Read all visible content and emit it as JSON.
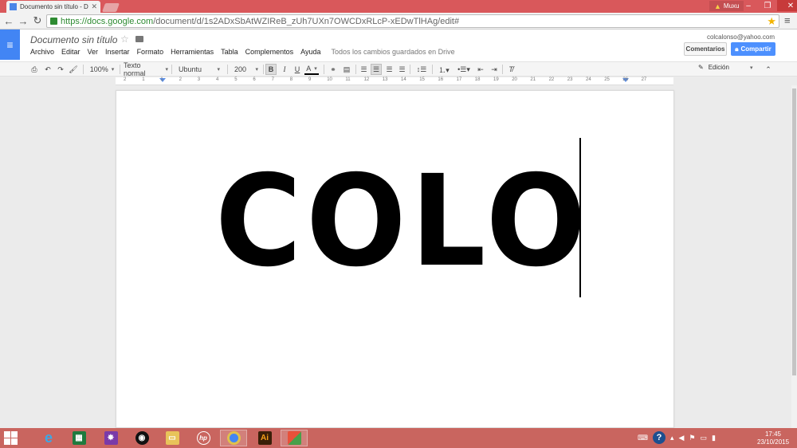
{
  "browser": {
    "tab_title": "Documento sin título - Docs",
    "url_main": "https://docs.google.com",
    "url_rest": "/document/d/1s2ADxSbAtWZIReB_zUh7UXn7OWCDxRLcP-xEDwTlHAg/edit#",
    "user_badge": "Muxu"
  },
  "docs": {
    "title": "Documento sin título",
    "menus": [
      "Archivo",
      "Editar",
      "Ver",
      "Insertar",
      "Formato",
      "Herramientas",
      "Tabla",
      "Complementos",
      "Ayuda"
    ],
    "saved_status": "Todos los cambios guardados en Drive",
    "email": "colcalonso@yahoo.com",
    "comments_label": "Comentarios",
    "share_label": "Compartir"
  },
  "toolbar": {
    "zoom": "100%",
    "style": "Texto normal",
    "font": "Ubuntu",
    "size": "200",
    "bold": "B",
    "italic": "I",
    "underline": "U",
    "text_color": "A",
    "mode": "Edición"
  },
  "ruler": [
    "2",
    "1",
    "1",
    "2",
    "3",
    "4",
    "5",
    "6",
    "7",
    "8",
    "9",
    "10",
    "11",
    "12",
    "13",
    "14",
    "15",
    "16",
    "17",
    "18",
    "19",
    "20",
    "21",
    "22",
    "23",
    "24",
    "25",
    "26",
    "27"
  ],
  "document": {
    "text": "COLO"
  },
  "taskbar": {
    "time": "17:45",
    "date": "23/10/2015"
  },
  "colors": {
    "chrome_frame": "#d9585b",
    "docs_blue": "#4285f4",
    "share_blue": "#4d90fe",
    "taskbar": "#c9655f",
    "url_green": "#2e8b32"
  }
}
